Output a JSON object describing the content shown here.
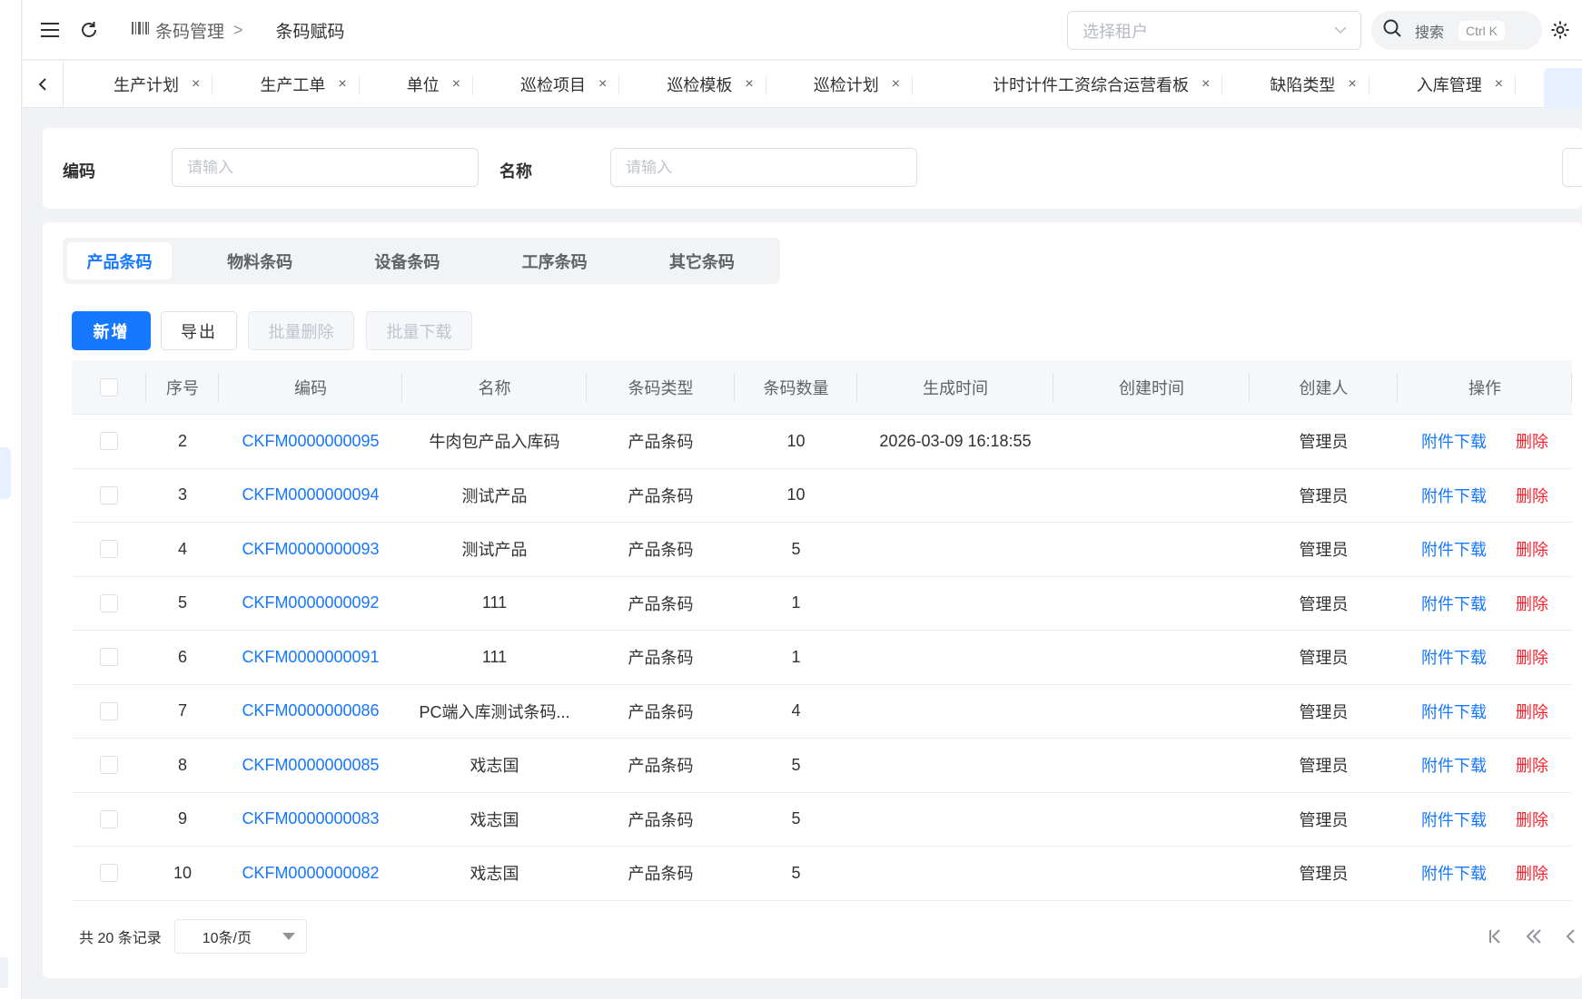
{
  "header": {
    "breadcrumb": [
      {
        "label": "条码管理",
        "icon": "barcode-icon"
      },
      {
        "label": "条码赋码"
      }
    ],
    "tenant_placeholder": "选择租户",
    "search_label": "搜索",
    "search_shortcut": "Ctrl K",
    "icons": [
      "menu-icon",
      "refresh-icon",
      "search-icon",
      "gear-icon"
    ]
  },
  "tabs": [
    {
      "label": "生产计划"
    },
    {
      "label": "生产工单"
    },
    {
      "label": "单位"
    },
    {
      "label": "巡检项目"
    },
    {
      "label": "巡检模板"
    },
    {
      "label": "巡检计划"
    },
    {
      "label": "计时计件工资综合运营看板"
    },
    {
      "label": "缺陷类型"
    },
    {
      "label": "入库管理"
    }
  ],
  "tab_close_glyph": "×",
  "filters": {
    "code_label": "编码",
    "code_placeholder": "请输入",
    "name_label": "名称",
    "name_placeholder": "请输入"
  },
  "segments": [
    {
      "label": "产品条码",
      "active": true
    },
    {
      "label": "物料条码",
      "active": false
    },
    {
      "label": "设备条码",
      "active": false
    },
    {
      "label": "工序条码",
      "active": false
    },
    {
      "label": "其它条码",
      "active": false
    }
  ],
  "toolbar": {
    "add_label": "新增",
    "export_label": "导出",
    "batch_delete_label": "批量删除",
    "batch_download_label": "批量下载"
  },
  "table": {
    "columns": [
      "序号",
      "编码",
      "名称",
      "条码类型",
      "条码数量",
      "生成时间",
      "创建时间",
      "创建人",
      "操作"
    ],
    "rows": [
      {
        "index": "2",
        "code": "CKFM0000000095",
        "name": "牛肉包产品入库码",
        "type": "产品条码",
        "qty": "10",
        "gen_time": "2026-03-09 16:18:55",
        "create_time": "",
        "creator": "管理员"
      },
      {
        "index": "3",
        "code": "CKFM0000000094",
        "name": "测试产品",
        "type": "产品条码",
        "qty": "10",
        "gen_time": "",
        "create_time": "",
        "creator": "管理员"
      },
      {
        "index": "4",
        "code": "CKFM0000000093",
        "name": "测试产品",
        "type": "产品条码",
        "qty": "5",
        "gen_time": "",
        "create_time": "",
        "creator": "管理员"
      },
      {
        "index": "5",
        "code": "CKFM0000000092",
        "name": "111",
        "type": "产品条码",
        "qty": "1",
        "gen_time": "",
        "create_time": "",
        "creator": "管理员"
      },
      {
        "index": "6",
        "code": "CKFM0000000091",
        "name": "111",
        "type": "产品条码",
        "qty": "1",
        "gen_time": "",
        "create_time": "",
        "creator": "管理员"
      },
      {
        "index": "7",
        "code": "CKFM0000000086",
        "name": "PC端入库测试条码...",
        "type": "产品条码",
        "qty": "4",
        "gen_time": "",
        "create_time": "",
        "creator": "管理员"
      },
      {
        "index": "8",
        "code": "CKFM0000000085",
        "name": "戏志国",
        "type": "产品条码",
        "qty": "5",
        "gen_time": "",
        "create_time": "",
        "creator": "管理员"
      },
      {
        "index": "9",
        "code": "CKFM0000000083",
        "name": "戏志国",
        "type": "产品条码",
        "qty": "5",
        "gen_time": "",
        "create_time": "",
        "creator": "管理员"
      },
      {
        "index": "10",
        "code": "CKFM0000000082",
        "name": "戏志国",
        "type": "产品条码",
        "qty": "5",
        "gen_time": "",
        "create_time": "",
        "creator": "管理员"
      }
    ],
    "action_download": "附件下载",
    "action_delete": "删除"
  },
  "pagination": {
    "total_text": "共 20 条记录",
    "page_size": "10条/页"
  },
  "colors": {
    "primary": "#1677ff",
    "danger": "#f5222d",
    "background": "#f0f2f5"
  }
}
